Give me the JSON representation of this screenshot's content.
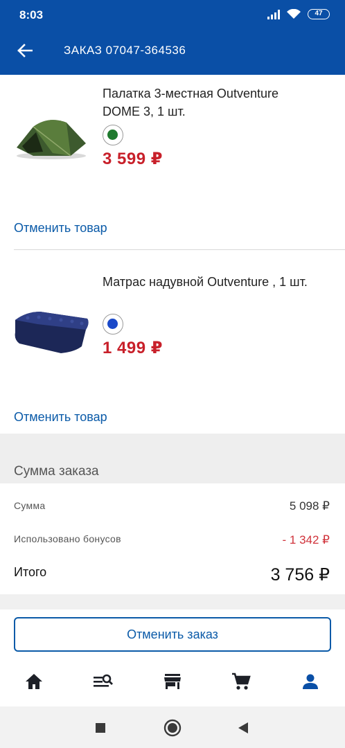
{
  "status_bar": {
    "time": "8:03",
    "battery": "47"
  },
  "header": {
    "title": "ЗАКАЗ 07047-364536"
  },
  "items": [
    {
      "name": "Палатка 3-местная Outventure DOME 3, 1 шт.",
      "color": "#1f7a2e",
      "price": "3 599 ₽",
      "cancel_label": "Отменить товар"
    },
    {
      "name": "Матрас надувной Outventure , 1 шт.",
      "color": "#1a49c9",
      "price": "1 499 ₽",
      "cancel_label": "Отменить товар"
    }
  ],
  "summary": {
    "title": "Сумма заказа",
    "sum_label": "Сумма",
    "sum_value": "5 098 ₽",
    "bonus_label": "Использовано бонусов",
    "bonus_value": "- 1 342 ₽",
    "total_label": "Итого",
    "total_value": "3 756 ₽"
  },
  "actions": {
    "cancel_order": "Отменить заказ"
  },
  "bottom_nav": [
    "home-icon",
    "catalog-search-icon",
    "store-icon",
    "cart-icon",
    "profile-icon"
  ],
  "colors": {
    "brand": "#0a4fa6",
    "price": "#c8202a",
    "link": "#0a5aa8"
  }
}
